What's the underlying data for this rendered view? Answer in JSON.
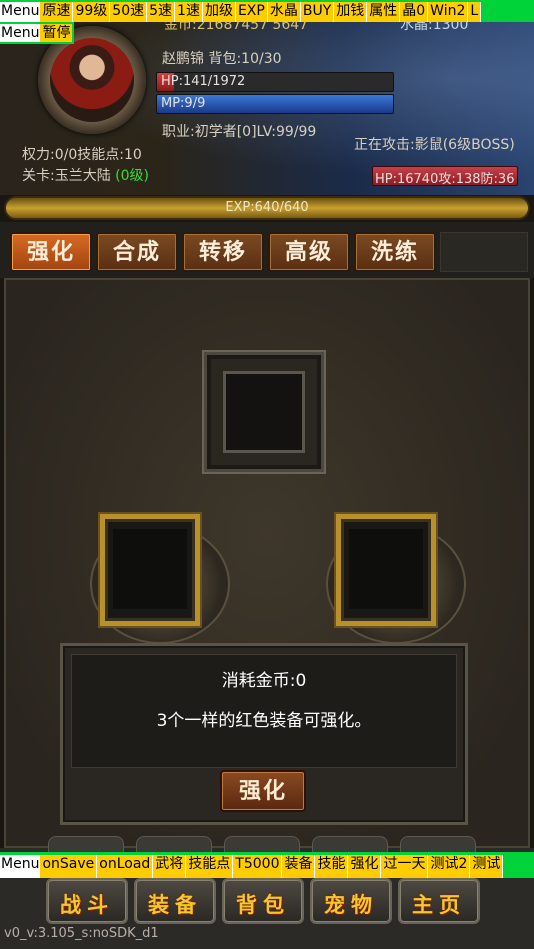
{
  "debug_top": {
    "menu_label": "Menu",
    "buttons": [
      "原速",
      "99级",
      "50速",
      "5速",
      "1速",
      "加级",
      "EXP",
      "水晶",
      "BUY",
      "加钱",
      "属性",
      "晶0",
      "Win2",
      "L"
    ]
  },
  "debug_second": {
    "menu_label": "Menu",
    "buttons": [
      "暂停"
    ]
  },
  "player": {
    "gold_partial": "金币:21687457 5647",
    "crystal_partial": "水晶:1300",
    "name_bag": "赵鹏锦 背包:10/30",
    "hp": "HP:141/1972",
    "hp_fraction": 0.0715,
    "mp": "MP:9/9",
    "mp_fraction": 1.0,
    "job_level": "职业:初学者[0]LV:99/99",
    "power_skill": "权力:0/0技能点:10",
    "stage_prefix": "关卡:玉兰大陆 ",
    "stage_level": "(0级)",
    "attacking": "正在攻击:影鼠(6级BOSS)",
    "enemy_stats": "HP:16740攻:138防:36",
    "exp": "EXP:640/640",
    "exp_fraction": 1.0
  },
  "tabs": [
    "强化",
    "合成",
    "转移",
    "高级",
    "洗练"
  ],
  "active_tab": "强化",
  "info": {
    "cost": "消耗金币:0",
    "hint": "3个一样的红色装备可强化。",
    "confirm_label": "强化"
  },
  "debug_bottom": {
    "menu_label": "Menu",
    "buttons": [
      "onSave",
      "onLoad",
      "武将",
      "技能点",
      "T5000",
      "装备",
      "技能",
      "强化",
      "过一天",
      "测试2",
      "测试"
    ]
  },
  "nav": [
    "战斗",
    "装备",
    "背包",
    "宠物",
    "主页"
  ],
  "version": "v0_v:3.105_s:noSDK_d1",
  "colors": {
    "debug_bar_bg": "#00d23a",
    "debug_button_bg": "#ffcc00",
    "active_tab": "#d86a22",
    "stage_level_color": "#3adc3a",
    "enemy_bar": "#c0303a"
  }
}
